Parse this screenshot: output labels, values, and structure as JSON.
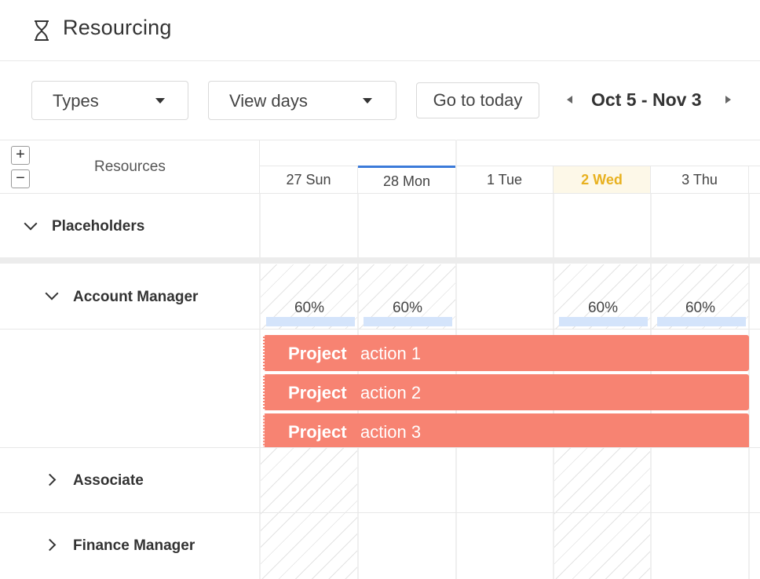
{
  "app": {
    "title": "Resourcing",
    "title_icon": "hourglass-icon"
  },
  "toolbar": {
    "types_label": "Types",
    "view_label": "View days",
    "today_label": "Go to today",
    "range_label": "Oct 5 - Nov 3"
  },
  "grid": {
    "resources_header": "Resources",
    "expand_symbol": "+",
    "collapse_symbol": "−",
    "days": [
      {
        "label": "27 Sun",
        "current": false,
        "today": false
      },
      {
        "label": "28 Mon",
        "current": true,
        "today": false
      },
      {
        "label": "1 Tue",
        "current": false,
        "today": false
      },
      {
        "label": "2 Wed",
        "current": false,
        "today": true
      },
      {
        "label": "3 Thu",
        "current": false,
        "today": false
      }
    ],
    "rows": [
      {
        "label": "Placeholders",
        "expanded": true
      },
      {
        "label": "Account Manager",
        "expanded": true,
        "allocations": [
          "60%",
          "60%",
          "",
          "60%",
          "60%"
        ]
      },
      {
        "label": "Associate",
        "expanded": false
      },
      {
        "label": "Finance Manager",
        "expanded": false
      }
    ],
    "projects": [
      {
        "name": "Project",
        "action": "action 1"
      },
      {
        "name": "Project",
        "action": "action 2"
      },
      {
        "name": "Project",
        "action": "action 3"
      }
    ]
  },
  "colors": {
    "accent": "#3b7ad9",
    "today": "#e8b120",
    "project": "#f78372",
    "allocation_bar": "#d4e4fb"
  }
}
